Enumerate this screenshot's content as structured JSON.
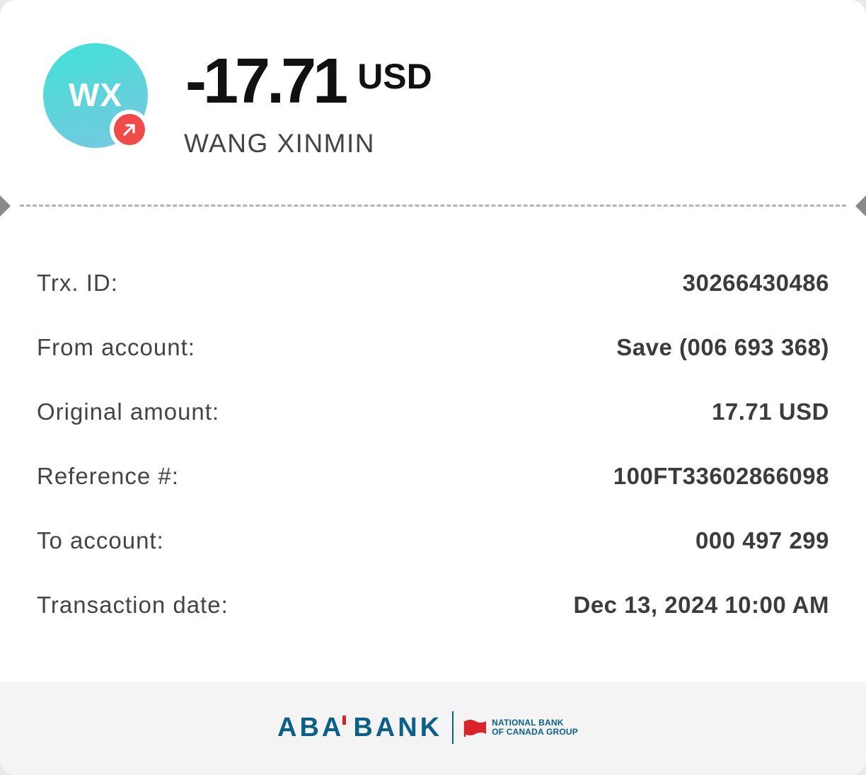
{
  "header": {
    "avatar_initials": "WX",
    "amount": "-17.71",
    "currency": "USD",
    "counterparty_name": "WANG XINMIN",
    "direction_icon": "arrow-up-right-icon"
  },
  "details": [
    {
      "label": "Trx. ID:",
      "value": "30266430486"
    },
    {
      "label": "From account:",
      "value": "Save (006 693 368)"
    },
    {
      "label": "Original amount:",
      "value": "17.71 USD"
    },
    {
      "label": "Reference #:",
      "value": "100FT33602866098"
    },
    {
      "label": "To account:",
      "value": "000 497 299"
    },
    {
      "label": "Transaction date:",
      "value": "Dec 13, 2024 10:00 AM"
    }
  ],
  "footer": {
    "brand_left": "ABA",
    "brand_right": "BANK",
    "partner_line1": "NATIONAL BANK",
    "partner_line2": "OF CANADA GROUP"
  },
  "colors": {
    "brand_blue": "#0c5f86",
    "brand_red": "#d8232a",
    "debit_red": "#ef4b4b",
    "avatar_teal": "#3fe3d6"
  }
}
